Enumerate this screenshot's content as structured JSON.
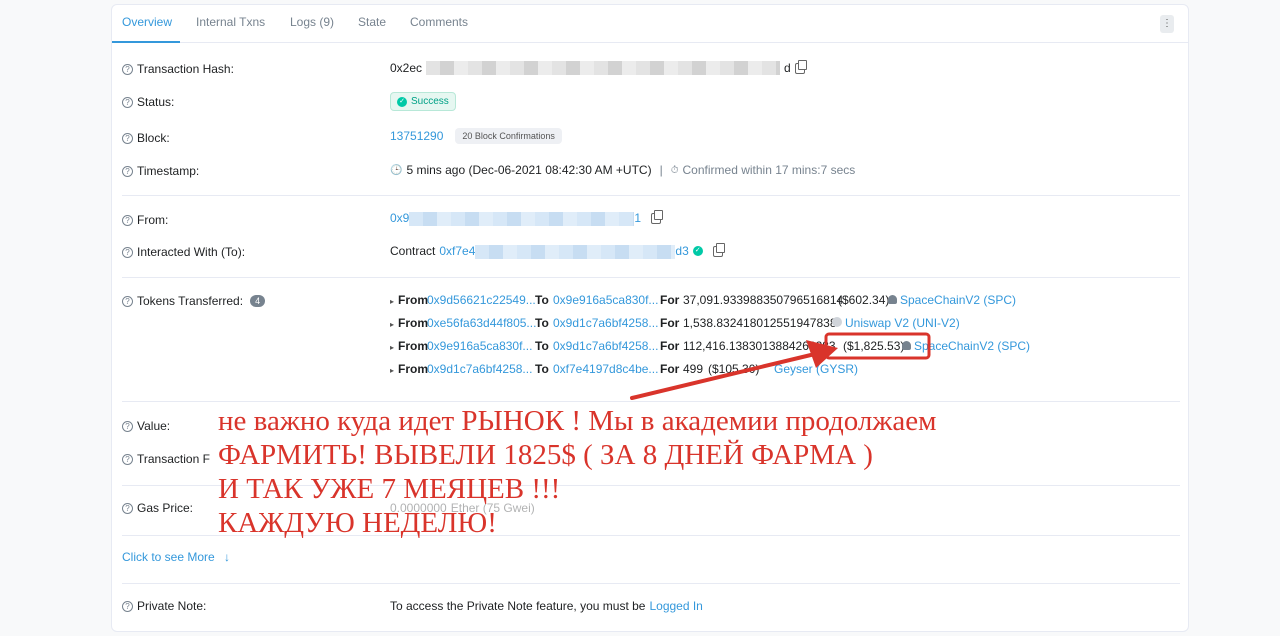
{
  "tabs": [
    {
      "label": "Overview",
      "active": true
    },
    {
      "label": "Internal Txns"
    },
    {
      "label": "Logs (9)"
    },
    {
      "label": "State"
    },
    {
      "label": "Comments"
    }
  ],
  "kebab": "⋮",
  "tx": {
    "hash_label": "Transaction Hash:",
    "hash_start": "0x2ec",
    "hash_end": "d",
    "status_label": "Status:",
    "status": "Success",
    "block_label": "Block:",
    "block": "13751290",
    "confirmations": "20 Block Confirmations",
    "timestamp_label": "Timestamp:",
    "timestamp": "5 mins ago (Dec-06-2021 08:42:30 AM +UTC)",
    "separator": "|",
    "confirmed": "Confirmed within 17 mins:7 secs",
    "from_label": "From:",
    "from_start": "0x9",
    "from_end": "1",
    "to_label": "Interacted With (To):",
    "to_prefix": "Contract",
    "to_start": "0xf7e4",
    "to_end": "d3",
    "tokens_label": "Tokens Transferred:",
    "tokens_count": "4",
    "value_label": "Value:",
    "fee_label": "Transaction F",
    "gas_label": "Gas Price:",
    "gas_value": "0.0000000",
    "gas_suffix": "Ether (75 Gwei)",
    "see_more": "Click to see More",
    "see_more_icon": "↓",
    "note_label": "Private Note:",
    "note_text": "To access the Private Note feature, you must be",
    "note_link": "Logged In"
  },
  "token_transfers": [
    {
      "from_kw": "From",
      "from": "0x9d56621c22549...",
      "to_kw": "To",
      "to": "0x9e916a5ca830f...",
      "for_kw": "For",
      "amount": "37,091.933988350796516814",
      "usd": "($602.34)",
      "token": "SpaceChainV2 (SPC)"
    },
    {
      "from_kw": "From",
      "from": "0xe56fa63d44f805...",
      "to_kw": "To",
      "to": "0x9d1c7a6bf4258...",
      "for_kw": "For",
      "amount": "1,538.832418012551947838",
      "usd": "",
      "token": "Uniswap V2 (UNI-V2)"
    },
    {
      "from_kw": "From",
      "from": "0x9e916a5ca830f...",
      "to_kw": "To",
      "to": "0x9d1c7a6bf4258...",
      "for_kw": "For",
      "amount": "112,416.1383013884262283",
      "usd": "($1,825.53)",
      "token": "SpaceChainV2 (SPC)"
    },
    {
      "from_kw": "From",
      "from": "0x9d1c7a6bf4258...",
      "to_kw": "To",
      "to": "0xf7e4197d8c4be...",
      "for_kw": "For",
      "amount": "499",
      "usd": "($105.30)",
      "token": "Geyser (GYSR)"
    }
  ],
  "overlay": {
    "line1": "не важно куда идет РЫНОК ! Мы в академии продолжаем",
    "line2": "ФАРМИТЬ! ВЫВЕЛИ 1825$ ( ЗА 8 ДНЕЙ ФАРМА )",
    "line3": "И ТАК УЖЕ 7 МЕЯЦЕВ !!!",
    "line4": "КАЖДУЮ НЕДЕЛЮ!"
  },
  "colors": {
    "accent": "#3498db",
    "success": "#00c9a7",
    "annotation": "#d9342b"
  }
}
